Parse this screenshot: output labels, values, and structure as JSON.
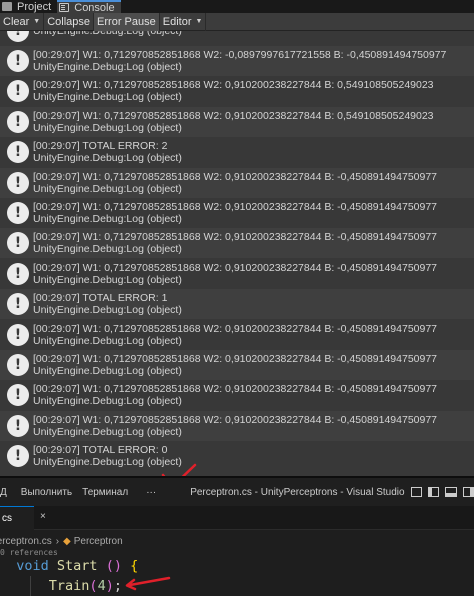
{
  "unity": {
    "tabs": [
      {
        "label": "Project",
        "icon": "folder-icon"
      },
      {
        "label": "Console",
        "icon": "console-icon"
      }
    ],
    "toolbar": {
      "clear": "Clear",
      "collapse": "Collapse",
      "error_pause": "Error Pause",
      "editor": "Editor"
    },
    "source": "UnityEngine.Debug:Log (object)",
    "logs": [
      "[00:29:07] W1: 0,712970852851868 W2: -0,0897997617721558 B: -0,450891494750977",
      "[00:29:07] W1: 0,712970852851868 W2: 0,910200238227844 B: 0,549108505249023",
      "[00:29:07] W1: 0,712970852851868 W2: 0,910200238227844 B: 0,549108505249023",
      "[00:29:07] TOTAL ERROR: 2",
      "[00:29:07] W1: 0,712970852851868 W2: 0,910200238227844 B: -0,450891494750977",
      "[00:29:07] W1: 0,712970852851868 W2: 0,910200238227844 B: -0,450891494750977",
      "[00:29:07] W1: 0,712970852851868 W2: 0,910200238227844 B: -0,450891494750977",
      "[00:29:07] W1: 0,712970852851868 W2: 0,910200238227844 B: -0,450891494750977",
      "[00:29:07] TOTAL ERROR: 1",
      "[00:29:07] W1: 0,712970852851868 W2: 0,910200238227844 B: -0,450891494750977",
      "[00:29:07] W1: 0,712970852851868 W2: 0,910200238227844 B: -0,450891494750977",
      "[00:29:07] W1: 0,712970852851868 W2: 0,910200238227844 B: -0,450891494750977",
      "[00:29:07] W1: 0,712970852851868 W2: 0,910200238227844 B: -0,450891494750977",
      "[00:29:07] TOTAL ERROR: 0"
    ],
    "icon": "info-icon"
  },
  "vscode": {
    "menu": [
      "Выполнить",
      "Терминал"
    ],
    "more": "···",
    "window_title": "Perceptron.cs - UnityPerceptrons - Visual Studio",
    "tab_label": "cs",
    "tab_close": "×",
    "breadcrumb": [
      "Perceptron.cs",
      "Perceptron"
    ],
    "breadcrumb_sep": "›",
    "codelens": "0 references",
    "code": {
      "void": "void",
      "start": "Start",
      "call": "Train",
      "arg": "4"
    },
    "annotation_color": "#e0202a"
  }
}
